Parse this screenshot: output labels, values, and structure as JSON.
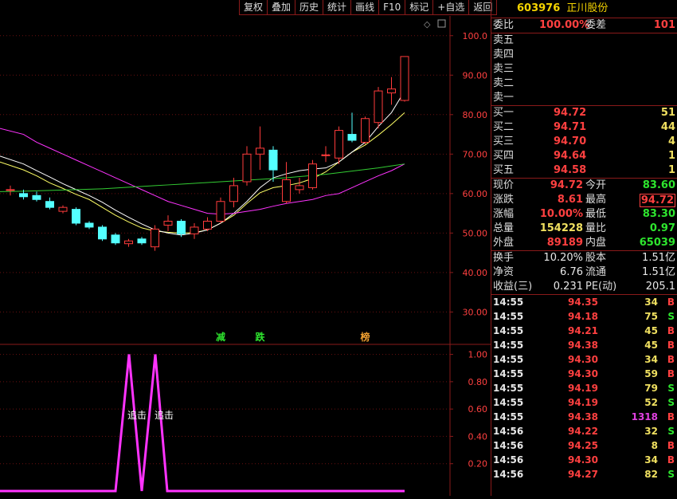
{
  "toolbar": [
    "复权",
    "叠加",
    "历史",
    "统计",
    "画线",
    "F10",
    "标记",
    "+自选",
    "返回"
  ],
  "stock": {
    "code": "603976",
    "name": "正川股份"
  },
  "weibi": {
    "label": "委比",
    "value": "100.00%",
    "diff_label": "委差",
    "diff": "101"
  },
  "sell": [
    {
      "label": "卖五",
      "price": "",
      "vol": ""
    },
    {
      "label": "卖四",
      "price": "",
      "vol": ""
    },
    {
      "label": "卖三",
      "price": "",
      "vol": ""
    },
    {
      "label": "卖二",
      "price": "",
      "vol": ""
    },
    {
      "label": "卖一",
      "price": "",
      "vol": ""
    }
  ],
  "buy": [
    {
      "label": "买一",
      "price": "94.72",
      "vol": "51"
    },
    {
      "label": "买二",
      "price": "94.71",
      "vol": "44"
    },
    {
      "label": "买三",
      "price": "94.70",
      "vol": "4"
    },
    {
      "label": "买四",
      "price": "94.64",
      "vol": "1"
    },
    {
      "label": "买五",
      "price": "94.58",
      "vol": "1"
    }
  ],
  "quote": [
    {
      "l1": "现价",
      "v1": "94.72",
      "c1": "red",
      "l2": "今开",
      "v2": "83.60",
      "c2": "green"
    },
    {
      "l1": "涨跌",
      "v1": "8.61",
      "c1": "red",
      "l2": "最高",
      "v2": "94.72",
      "c2": "red"
    },
    {
      "l1": "涨幅",
      "v1": "10.00%",
      "c1": "red",
      "l2": "最低",
      "v2": "83.30",
      "c2": "green"
    },
    {
      "l1": "总量",
      "v1": "154228",
      "c1": "yellow",
      "l2": "量比",
      "v2": "0.97",
      "c2": "green"
    },
    {
      "l1": "外盘",
      "v1": "89189",
      "c1": "red",
      "l2": "内盘",
      "v2": "65039",
      "c2": "green"
    }
  ],
  "stats": [
    {
      "l1": "换手",
      "v1": "10.20%",
      "l2": "股本",
      "v2": "1.51亿"
    },
    {
      "l1": "净资",
      "v1": "6.76",
      "l2": "流通",
      "v2": "1.51亿"
    },
    {
      "l1": "收益(三)",
      "v1": "0.231",
      "l2": "PE(动)",
      "v2": "205.1"
    }
  ],
  "ticks": [
    {
      "t": "14:55",
      "p": "94.35",
      "v": "34",
      "s": "B"
    },
    {
      "t": "14:55",
      "p": "94.18",
      "v": "75",
      "s": "S"
    },
    {
      "t": "14:55",
      "p": "94.21",
      "v": "45",
      "s": "B"
    },
    {
      "t": "14:55",
      "p": "94.38",
      "v": "45",
      "s": "B"
    },
    {
      "t": "14:55",
      "p": "94.30",
      "v": "34",
      "s": "B"
    },
    {
      "t": "14:55",
      "p": "94.30",
      "v": "59",
      "s": "B"
    },
    {
      "t": "14:55",
      "p": "94.19",
      "v": "79",
      "s": "S"
    },
    {
      "t": "14:55",
      "p": "94.19",
      "v": "52",
      "s": "S"
    },
    {
      "t": "14:55",
      "p": "94.38",
      "v": "1318",
      "s": "B"
    },
    {
      "t": "14:56",
      "p": "94.22",
      "v": "32",
      "s": "S"
    },
    {
      "t": "14:56",
      "p": "94.25",
      "v": "8",
      "s": "B"
    },
    {
      "t": "14:56",
      "p": "94.30",
      "v": "34",
      "s": "B"
    },
    {
      "t": "14:56",
      "p": "94.27",
      "v": "82",
      "s": "S"
    }
  ],
  "chart_data": {
    "type": "candlestick",
    "price_axis": {
      "ticks": [
        "100.0",
        "90.00",
        "80.00",
        "70.00",
        "60.00",
        "50.00",
        "40.00",
        "30.00"
      ],
      "values": [
        100,
        90,
        80,
        70,
        60,
        50,
        40,
        30
      ],
      "ylim": [
        22,
        105
      ]
    },
    "candles": [
      {
        "o": 61,
        "c": 61,
        "h": 62,
        "l": 59.5
      },
      {
        "o": 60,
        "c": 59.2,
        "h": 61,
        "l": 58.5
      },
      {
        "o": 59.5,
        "c": 58.5,
        "h": 60.5,
        "l": 58
      },
      {
        "o": 58,
        "c": 56.5,
        "h": 59,
        "l": 56
      },
      {
        "o": 55.5,
        "c": 56.5,
        "h": 57,
        "l": 55
      },
      {
        "o": 56,
        "c": 52.5,
        "h": 56.5,
        "l": 52
      },
      {
        "o": 52.5,
        "c": 51.5,
        "h": 53,
        "l": 51
      },
      {
        "o": 51.5,
        "c": 48.5,
        "h": 52,
        "l": 48
      },
      {
        "o": 49.5,
        "c": 47.5,
        "h": 50,
        "l": 47
      },
      {
        "o": 47.3,
        "c": 48,
        "h": 48.5,
        "l": 46.5
      },
      {
        "o": 48.5,
        "c": 47.5,
        "h": 49,
        "l": 47
      },
      {
        "o": 46.5,
        "c": 51,
        "h": 52,
        "l": 45.5
      },
      {
        "o": 52,
        "c": 53,
        "h": 54.5,
        "l": 50.5
      },
      {
        "o": 53,
        "c": 49.8,
        "h": 53.5,
        "l": 49
      },
      {
        "o": 49.8,
        "c": 51.5,
        "h": 52.5,
        "l": 48.5
      },
      {
        "o": 51,
        "c": 53,
        "h": 54,
        "l": 50.5
      },
      {
        "o": 53,
        "c": 58,
        "h": 59,
        "l": 52.5
      },
      {
        "o": 58,
        "c": 62,
        "h": 64,
        "l": 56.5
      },
      {
        "o": 63,
        "c": 70,
        "h": 72,
        "l": 62
      },
      {
        "o": 70,
        "c": 71.5,
        "h": 77,
        "l": 66
      },
      {
        "o": 71,
        "c": 66,
        "h": 72,
        "l": 63
      },
      {
        "o": 58,
        "c": 63.5,
        "h": 68,
        "l": 57.5
      },
      {
        "o": 61,
        "c": 62,
        "h": 64,
        "l": 60
      },
      {
        "o": 61.5,
        "c": 67.5,
        "h": 68.5,
        "l": 61
      },
      {
        "o": 69.8,
        "c": 69.8,
        "h": 72,
        "l": 68
      },
      {
        "o": 69,
        "c": 76,
        "h": 77,
        "l": 67.5
      },
      {
        "o": 75,
        "c": 73.5,
        "h": 80.5,
        "l": 73
      },
      {
        "o": 73,
        "c": 79,
        "h": 79.5,
        "l": 72.5
      },
      {
        "o": 78,
        "c": 86,
        "h": 87,
        "l": 76.5
      },
      {
        "o": 85.5,
        "c": 86.5,
        "h": 89.5,
        "l": 82.5
      },
      {
        "o": 83.6,
        "c": 94.72,
        "h": 94.72,
        "l": 83.3
      }
    ],
    "ma_series": [
      {
        "color": "#ffff66",
        "values": [
          68,
          66,
          64.5,
          62.7,
          61.3,
          59.8,
          58.5,
          56.5,
          54.5,
          52.8,
          51.3,
          50.5,
          50.2,
          50,
          50.1,
          50.8,
          52.5,
          54.5,
          57.5,
          60.2,
          61.5,
          62,
          62.7,
          63.8,
          65.5,
          68,
          70.5,
          72.3,
          74.8,
          77.5,
          80.5
        ]
      },
      {
        "color": "#ffffff",
        "values": [
          69.5,
          67.5,
          65.8,
          64.2,
          62.5,
          61,
          59.5,
          57.8,
          55.8,
          54,
          52.3,
          50.8,
          50,
          49.5,
          50,
          50.8,
          52.5,
          55,
          58,
          61.5,
          64,
          65,
          65.8,
          66.2,
          66.5,
          68,
          70.5,
          73,
          77,
          80.5,
          86
        ]
      },
      {
        "color": "#ff33ff",
        "values": [
          76.5,
          75,
          73,
          71.5,
          70,
          68.5,
          67,
          65.5,
          64,
          62.5,
          61,
          59.5,
          58,
          57,
          56,
          55,
          54.8,
          55,
          55.5,
          56,
          56.8,
          57.5,
          58,
          58.5,
          59.5,
          60,
          61.5,
          63,
          64.5,
          65.8,
          67.5
        ]
      },
      {
        "color": "#33cc33",
        "values": [
          60.5,
          60.6,
          60.7,
          60.8,
          60.9,
          61,
          61.1,
          61.2,
          61.4,
          61.6,
          61.8,
          62,
          62.2,
          62.4,
          62.6,
          62.8,
          63,
          63.2,
          63.4,
          63.6,
          63.8,
          64,
          64.3,
          64.6,
          64.9,
          65.3,
          65.7,
          66.1,
          66.5,
          67,
          67.5
        ]
      }
    ],
    "markers": [
      {
        "text": "减",
        "index": 16,
        "color": "#2ee52e"
      },
      {
        "text": "跌",
        "index": 19,
        "color": "#2ee52e"
      },
      {
        "text": "榜",
        "index": 27,
        "color": "#f0a030"
      }
    ],
    "indicator": {
      "axis": {
        "ticks": [
          "1.00",
          "0.80",
          "0.60",
          "0.40",
          "0.20"
        ],
        "values": [
          1,
          0.8,
          0.6,
          0.4,
          0.2
        ],
        "ylim": [
          0,
          1.05
        ]
      },
      "x": [
        0,
        145,
        162,
        178,
        195,
        210,
        508
      ],
      "values": [
        0,
        0,
        1,
        0,
        1,
        0,
        0
      ],
      "labels": [
        {
          "text": "追击",
          "x": 172
        },
        {
          "text": "追击",
          "x": 206
        }
      ],
      "color": "#ff33ff"
    }
  }
}
